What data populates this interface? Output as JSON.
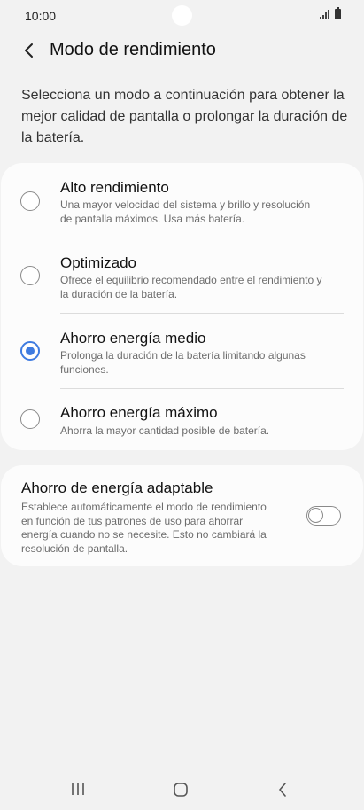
{
  "status_bar": {
    "time": "10:00",
    "icons": [
      "signal-icon",
      "battery-icon"
    ]
  },
  "header": {
    "back_icon": "chevron-left-icon",
    "title": "Modo de rendimiento"
  },
  "intro_text": "Selecciona un modo a continuación para obtener la mejor calidad de pantalla o prolongar la duración de la batería.",
  "modes": [
    {
      "title": "Alto rendimiento",
      "desc_lines": [
        "Una mayor velocidad del sistema y brillo y resolución",
        "de pantalla máximos. Usa más batería."
      ],
      "selected": false
    },
    {
      "title": "Optimizado",
      "desc_lines": [
        "Ofrece el equilibrio recomendado entre el rendimiento y",
        "la duración de la batería."
      ],
      "selected": false
    },
    {
      "title": "Ahorro energía medio",
      "desc_lines": [
        "Prolonga la duración de la batería limitando algunas",
        "funciones."
      ],
      "selected": true
    },
    {
      "title": "Ahorro energía máximo",
      "desc_lines": [
        "Ahorra la mayor cantidad posible de batería."
      ],
      "selected": false
    }
  ],
  "adaptive": {
    "title": "Ahorro de energía adaptable",
    "desc_lines": [
      "Establece automáticamente el modo de rendimiento",
      "en función de tus patrones de uso para ahorrar",
      "energía cuando no se necesite. Esto no cambiará la",
      "resolución de pantalla."
    ],
    "enabled": false
  },
  "nav_bar": {
    "icons": [
      "recents-icon",
      "home-icon",
      "back-icon"
    ]
  },
  "colors": {
    "background": "#f2f2f2",
    "card": "#fcfcfc",
    "accent": "#3e7be0",
    "secondary_text": "#6d6d6d"
  }
}
